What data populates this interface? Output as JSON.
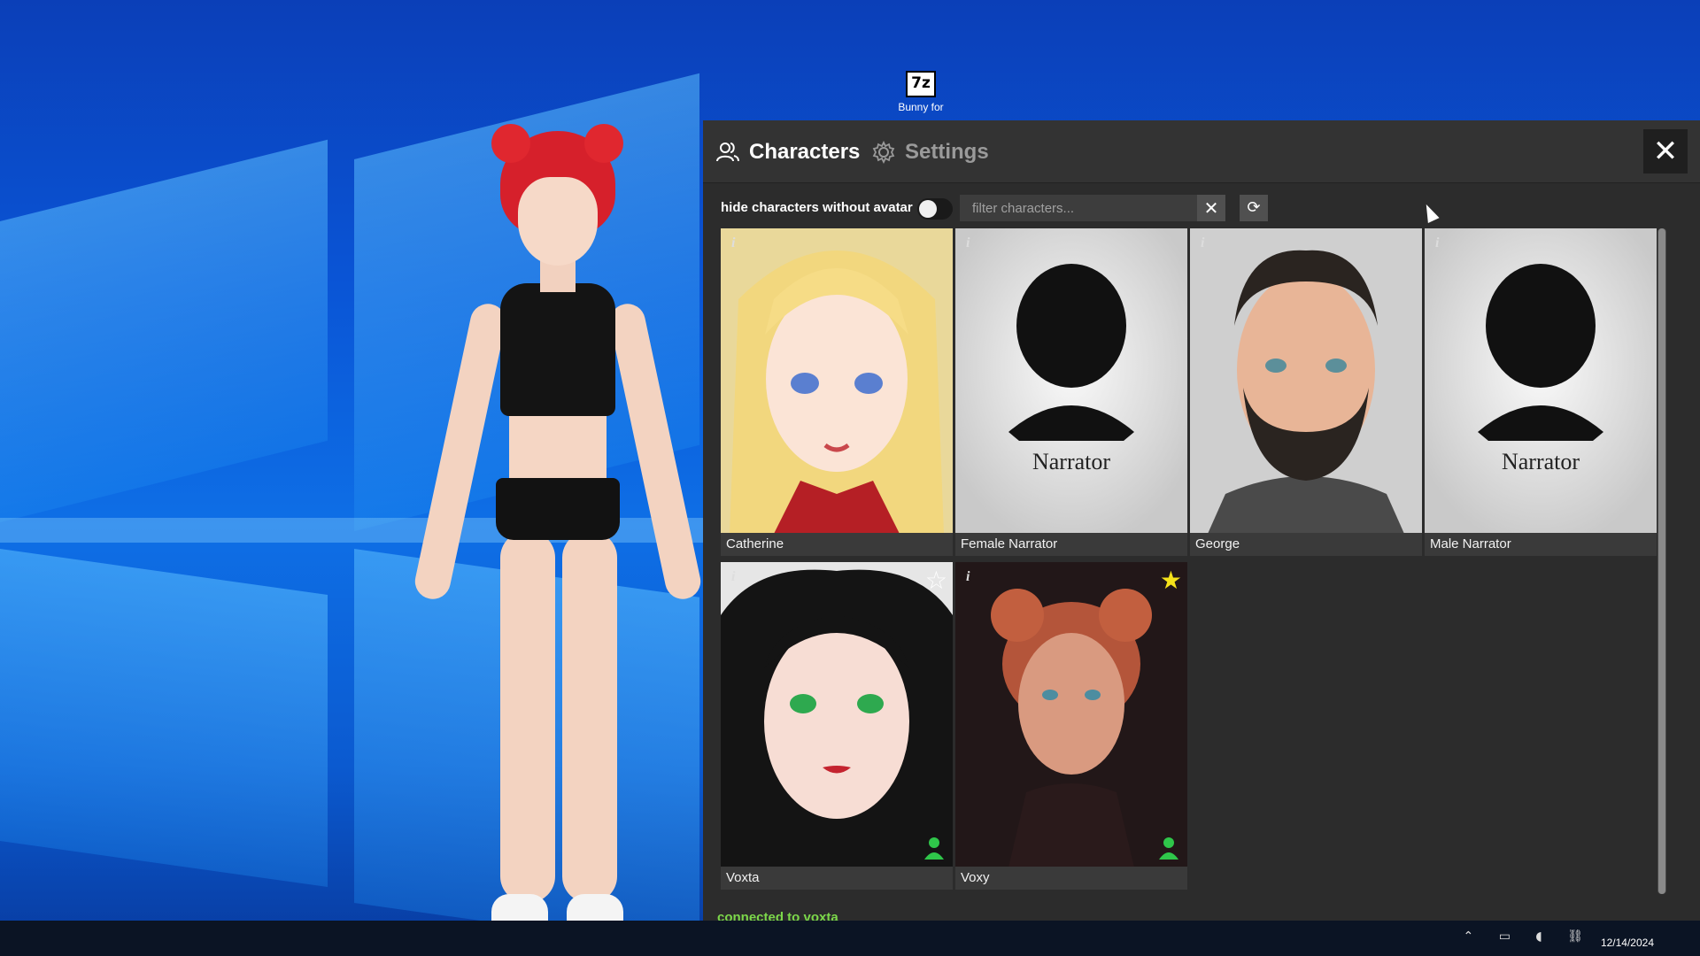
{
  "desktop": {
    "icon": {
      "glyph": "7z",
      "label": "Bunny for"
    }
  },
  "panel": {
    "tabs": [
      {
        "label": "Characters",
        "icon": "people-icon",
        "active": true
      },
      {
        "label": "Settings",
        "icon": "gear-icon",
        "active": false
      }
    ],
    "close_label": "✕",
    "toolbar": {
      "toggle_label": "hide characters without avatar",
      "toggle_on": false,
      "filter_placeholder": "filter characters...",
      "filter_value": "",
      "clear_label": "✕",
      "refresh_label": "⟳"
    },
    "characters": [
      {
        "name": "Catherine",
        "info": "i",
        "favorite": false,
        "selected": false
      },
      {
        "name": "Female Narrator",
        "info": "i",
        "favorite": false,
        "selected": false,
        "avatar_text": "Narrator"
      },
      {
        "name": "George",
        "info": "i",
        "favorite": false,
        "selected": false
      },
      {
        "name": "Male Narrator",
        "info": "i",
        "favorite": false,
        "selected": false,
        "avatar_text": "Narrator"
      },
      {
        "name": "Voxta",
        "info": "i",
        "favorite": false,
        "star": "☆",
        "selected": false
      },
      {
        "name": "Voxy",
        "info": "i",
        "favorite": true,
        "star": "★",
        "selected": true
      }
    ],
    "status": "connected to voxta"
  },
  "taskbar": {
    "date": "12/14/2024"
  },
  "colors": {
    "panel_bg": "#2c2c2c",
    "status_green": "#7cd84a",
    "favorite_yellow": "#f5e21a",
    "selected_outline": "#3ec94a"
  }
}
